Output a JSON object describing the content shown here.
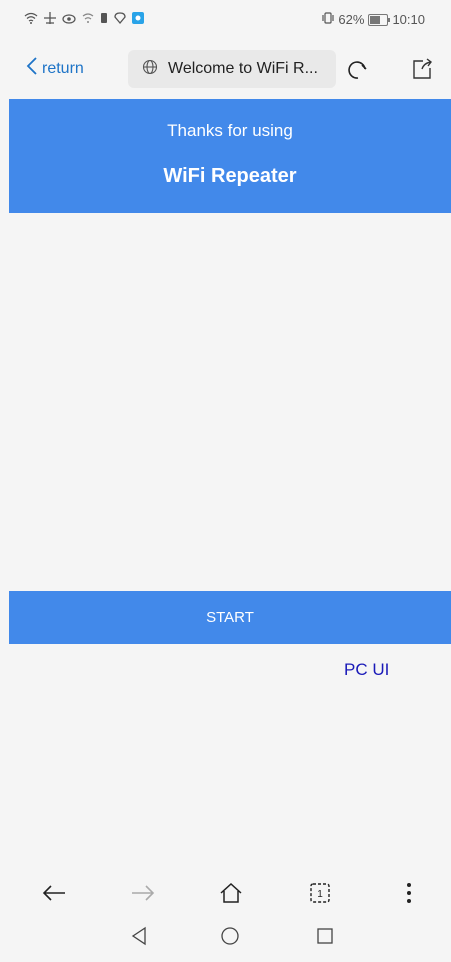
{
  "status_bar": {
    "left_icons": [
      "wifi-icon",
      "airplane-icon",
      "eye-icon",
      "wifi-icon",
      "sim-icon",
      "location-icon",
      "app-icon"
    ],
    "battery_percent": "62%",
    "battery_level": 0.62,
    "time": "10:10"
  },
  "browser": {
    "return_label": "return",
    "url_text": "Welcome to WiFi R..."
  },
  "header": {
    "subtitle": "Thanks for using",
    "title": "WiFi Repeater"
  },
  "start_button": "START",
  "pc_ui_link": "PC UI",
  "colors": {
    "accent": "#4289ea",
    "link": "#1a1ab8",
    "return": "#1e74c7"
  }
}
